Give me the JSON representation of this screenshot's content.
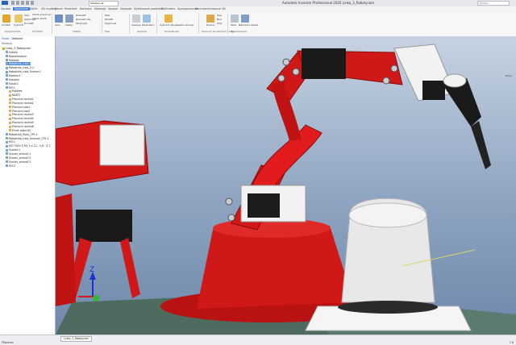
{
  "window": {
    "title": "Autodesk Inventor Professional 2020   Linka_3_Roboty.iam",
    "search_placeholder": "Vyhledat"
  },
  "quick_access": {
    "style_value": "Všeobecné"
  },
  "tabs": [
    "Soubor",
    "Sestavení",
    "Náčrt",
    "3D modely",
    "Návrh",
    "Prostředí",
    "Kontrola",
    "Nástroje",
    "Správa",
    "Zobrazit",
    "Systémové prostředí",
    "Začínáme",
    "Spolupracovat",
    "Electromechanical",
    "3D"
  ],
  "ribbon": {
    "groups": [
      {
        "name": "Komponenta",
        "buttons": [
          "Umístit",
          "Vytvořit"
        ],
        "small": [
          "Vzor",
          "Kopírovat",
          "Zrcadlit"
        ]
      },
      {
        "name": "Umístění",
        "buttons": [
          "Spoj",
          "Vazby"
        ],
        "small": [
          "Volně posunout",
          "Volně otočit",
          "Zobrazit",
          "Zobrazit vše",
          "Skrýt vše"
        ]
      },
      {
        "name": "Vztahy",
        "buttons": [],
        "small": [
          "Pole",
          "Zkrátit",
          "Kopírovat"
        ]
      },
      {
        "name": "Pole",
        "buttons": [
          "Osa",
          "Rovina",
          "Bod"
        ],
        "small": []
      },
      {
        "name": "Správce",
        "buttons": [
          "Svazuje",
          "Parametry"
        ],
        "small": []
      },
      {
        "name": "Produktivita",
        "buttons": [
          "Vytvořit",
          "Nahradit"
        ],
        "small": [
          "Vytvořit uživatelské rohovky"
        ]
      },
      {
        "name": "Pracovní konstrukční prvky",
        "buttons": [
          "Rovina"
        ],
        "small": [
          "Osa",
          "Bod",
          "UCS"
        ]
      },
      {
        "name": "Zjednodušení",
        "buttons": [
          "Obal",
          "Náhradní objekt"
        ],
        "small": []
      }
    ]
  },
  "browser": {
    "tabs": [
      "Model",
      "Oblíbené"
    ],
    "header": "Sestava",
    "items": [
      {
        "label": "Linka_3_Roboty.iam",
        "level": 0
      },
      {
        "label": "Vztahy",
        "level": 1
      },
      {
        "label": "Reprezentace",
        "level": 1
      },
      {
        "label": "Počátek",
        "level": 1
      },
      {
        "label": "Robotická_ruka:1",
        "level": 1,
        "selected": true
      },
      {
        "label": "Robotická_ruka_2:1",
        "level": 1
      },
      {
        "label": "Robotická_ruka_Scaner:1",
        "level": 1
      },
      {
        "label": "Kladivo:1",
        "level": 1
      },
      {
        "label": "Sroubky",
        "level": 1
      },
      {
        "label": "Kloub:1",
        "level": 1
      },
      {
        "label": "M3:1",
        "level": 1
      },
      {
        "label": "Počátek",
        "level": 2
      },
      {
        "label": "NAKT2",
        "level": 2
      },
      {
        "label": "Pracovní rovina1",
        "level": 2
      },
      {
        "label": "Pracovní rovina2",
        "level": 2
      },
      {
        "label": "Pracovní osa1",
        "level": 2
      },
      {
        "label": "Pracovní osa2",
        "level": 2
      },
      {
        "label": "Pracovní rovina3",
        "level": 2
      },
      {
        "label": "Pracovní rovina4",
        "level": 2
      },
      {
        "label": "Pracovní rovina5",
        "level": 2
      },
      {
        "label": "Pracovní rovina6",
        "level": 2
      },
      {
        "label": "Prvek odstr.(0)",
        "level": 2
      },
      {
        "label": "Robotická_Ruka_CP1:1",
        "level": 1
      },
      {
        "label": "Robotická_ruka_Scanner_CP1:1",
        "level": 1
      },
      {
        "label": "M3:1",
        "level": 1
      },
      {
        "label": "ISO 7045 Z M2,5 x 12 - 4,8 - Z:1",
        "level": 1
      },
      {
        "label": "Scaner:1",
        "level": 1
      },
      {
        "label": "Scaner_snímač:1",
        "level": 1
      },
      {
        "label": "Scaner_snímač:2",
        "level": 1
      },
      {
        "label": "Scaner_snímač:3",
        "level": 1
      },
      {
        "label": "M3:2",
        "level": 1
      }
    ]
  },
  "document_tab": "Linka_3_Roboty.iam",
  "status": {
    "left": "Připraven",
    "right": "1   8"
  },
  "viewcube": {
    "label": "Pravý"
  },
  "colors": {
    "accent": "#3b7bd0",
    "robot_red": "#d01818",
    "selection": "#4a86d8"
  },
  "icons": [
    "file-icon",
    "save-icon",
    "undo-icon",
    "redo-icon",
    "place-component-icon",
    "create-component-icon",
    "joint-icon",
    "constrain-icon",
    "pattern-icon",
    "axis-icon",
    "plane-icon",
    "point-icon",
    "parameters-icon",
    "folder-icon",
    "part-icon",
    "assembly-icon"
  ]
}
